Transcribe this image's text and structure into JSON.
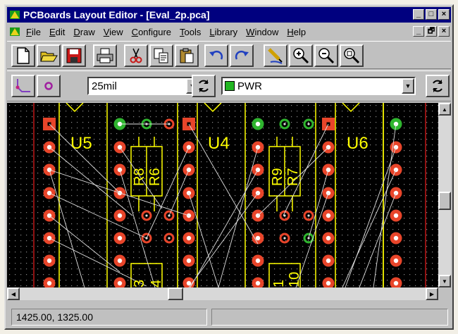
{
  "window": {
    "title": "PCBoards Layout Editor - [Eval_2p.pca]",
    "title_buttons": [
      "_",
      "□",
      "×"
    ],
    "mdi_buttons": [
      "_",
      "🗗",
      "×"
    ]
  },
  "menu": [
    {
      "label": "File",
      "key": "F",
      "rest": "ile"
    },
    {
      "label": "Edit",
      "key": "E",
      "rest": "dit"
    },
    {
      "label": "Draw",
      "key": "D",
      "rest": "raw"
    },
    {
      "label": "View",
      "key": "V",
      "rest": "iew"
    },
    {
      "label": "Configure",
      "key": "C",
      "rest": "onfigure"
    },
    {
      "label": "Tools",
      "key": "T",
      "rest": "ools"
    },
    {
      "label": "Library",
      "key": "L",
      "rest": "ibrary"
    },
    {
      "label": "Window",
      "key": "W",
      "rest": "indow"
    },
    {
      "label": "Help",
      "key": "H",
      "rest": "elp"
    }
  ],
  "toolbar": {
    "buttons": [
      "new-file-icon",
      "open-folder-icon",
      "save-disk-icon",
      "print-icon",
      "cut-scissors-icon",
      "copy-icon",
      "paste-icon",
      "undo-icon",
      "redo-icon",
      "route-pen-icon",
      "zoom-in-icon",
      "zoom-out-icon",
      "zoom-fit-icon"
    ]
  },
  "toolbar2": {
    "trace_width": "25mil",
    "net": "PWR",
    "net_color": "#21b521",
    "icons": [
      "route-trace-icon",
      "via-icon",
      "refresh-icon",
      "refresh-icon"
    ]
  },
  "board": {
    "components": {
      "ics": [
        "U5",
        "U4",
        "U6"
      ],
      "resistors_vertical": [
        "R8",
        "R6",
        "R9",
        "R7"
      ],
      "partial_labels": [
        "3",
        "4",
        "1",
        "10"
      ]
    },
    "colors": {
      "background": "#000000",
      "silkscreen": "#ffff00",
      "pad": "#e8452a",
      "pad_square": "#e8452a",
      "pad_green": "#2fb52f",
      "ratsnest": "#e0e0e0",
      "dot_grid": "#8a8a8a",
      "border_line": "#c01818"
    }
  },
  "status": {
    "coordinates": "1425.00, 1325.00"
  }
}
